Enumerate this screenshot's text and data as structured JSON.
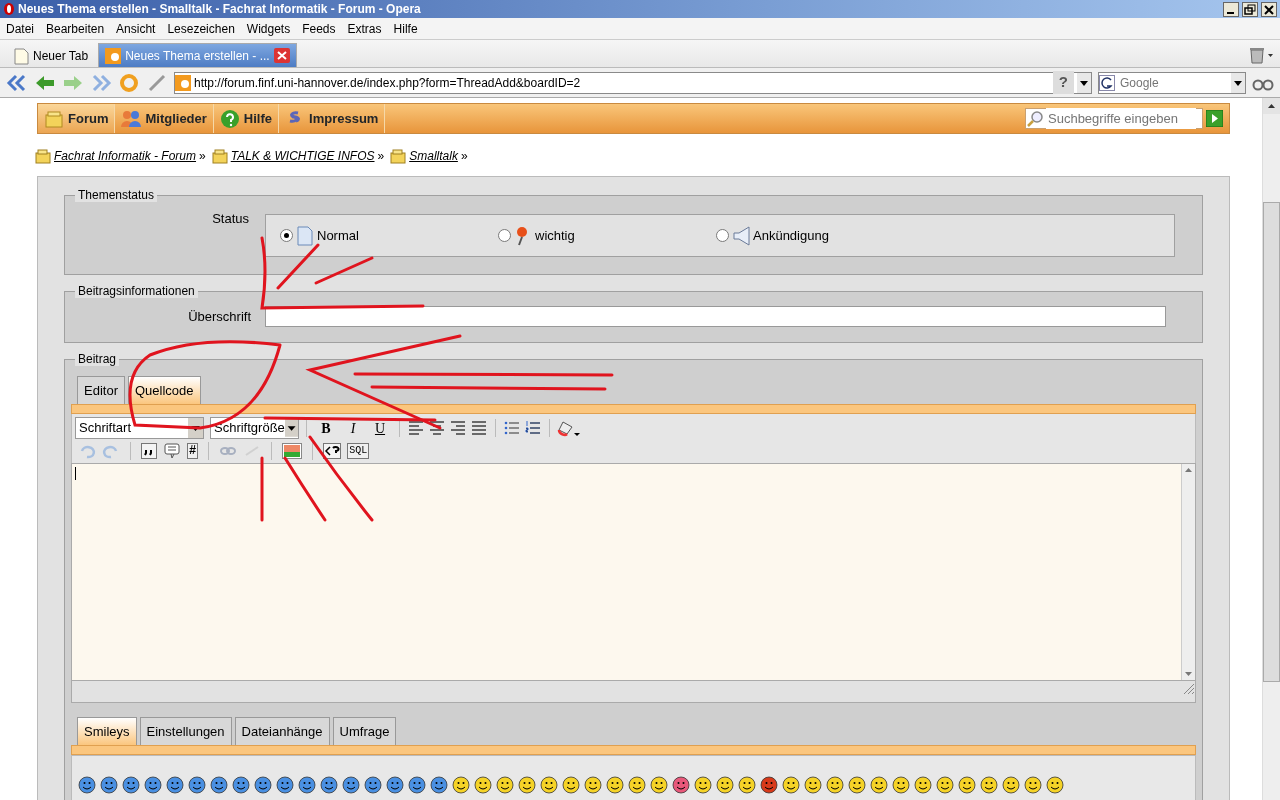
{
  "window": {
    "title": "Neues Thema erstellen - Smalltalk - Fachrat Informatik - Forum - Opera"
  },
  "menu": [
    "Datei",
    "Bearbeiten",
    "Ansicht",
    "Lesezeichen",
    "Widgets",
    "Feeds",
    "Extras",
    "Hilfe"
  ],
  "browser_tabs": [
    {
      "label": "Neuer Tab",
      "selected": false
    },
    {
      "label": "Neues Thema erstellen - ...",
      "selected": true
    }
  ],
  "address_bar": {
    "url": "http://forum.finf.uni-hannover.de/index.php?form=ThreadAdd&boardID=2",
    "help": "?"
  },
  "search_engine": {
    "placeholder": "Google"
  },
  "forum_nav": [
    {
      "label": "Forum",
      "kind": "folder",
      "selected": true
    },
    {
      "label": "Mitglieder",
      "kind": "members",
      "selected": false
    },
    {
      "label": "Hilfe",
      "kind": "help",
      "selected": false
    },
    {
      "label": "Impressum",
      "kind": "paragraph",
      "selected": false
    }
  ],
  "forum_search": {
    "placeholder": "Suchbegriffe eingeben"
  },
  "breadcrumb": [
    {
      "label": "Fachrat Informatik - Forum",
      "sep": "»"
    },
    {
      "label": "TALK & WICHTIGE INFOS",
      "sep": "»"
    },
    {
      "label": "Smalltalk",
      "sep": "»"
    }
  ],
  "themenstatus": {
    "legend": "Themenstatus",
    "label": "Status",
    "options": [
      {
        "label": "Normal",
        "selected": true,
        "kind": "page"
      },
      {
        "label": "wichtig",
        "selected": false,
        "kind": "pin"
      },
      {
        "label": "Ankündigung",
        "selected": false,
        "kind": "megaphone"
      }
    ]
  },
  "beitragsinfo": {
    "legend": "Beitragsinformationen",
    "label": "Überschrift"
  },
  "beitrag": {
    "legend": "Beitrag",
    "editor_tabs": [
      {
        "label": "Editor",
        "selected": false
      },
      {
        "label": "Quellcode",
        "selected": true
      }
    ],
    "font_select": "Schriftart",
    "size_select": "Schriftgröße",
    "format_buttons": [
      "B",
      "I",
      "U"
    ],
    "hash_button": "#",
    "sql_button": "SQL",
    "bottom_tabs": [
      {
        "label": "Smileys",
        "selected": true
      },
      {
        "label": "Einstellungen",
        "selected": false
      },
      {
        "label": "Dateianhänge",
        "selected": false
      },
      {
        "label": "Umfrage",
        "selected": false
      }
    ],
    "smileys": [
      {
        "color": "#4a90e2"
      },
      {
        "color": "#4a90e2"
      },
      {
        "color": "#4a90e2"
      },
      {
        "color": "#4a90e2"
      },
      {
        "color": "#4a90e2"
      },
      {
        "color": "#4a90e2"
      },
      {
        "color": "#4a90e2"
      },
      {
        "color": "#4a90e2"
      },
      {
        "color": "#4a90e2"
      },
      {
        "color": "#4a90e2"
      },
      {
        "color": "#4a90e2"
      },
      {
        "color": "#4a90e2"
      },
      {
        "color": "#4a90e2"
      },
      {
        "color": "#4a90e2"
      },
      {
        "color": "#4a90e2"
      },
      {
        "color": "#4a90e2"
      },
      {
        "color": "#4a90e2"
      },
      {
        "color": "#f5d327"
      },
      {
        "color": "#f5d327"
      },
      {
        "color": "#f5d327"
      },
      {
        "color": "#f5d327"
      },
      {
        "color": "#f5d327"
      },
      {
        "color": "#f5d327"
      },
      {
        "color": "#f5d327"
      },
      {
        "color": "#f5d327"
      },
      {
        "color": "#f5d327"
      },
      {
        "color": "#f5d327"
      },
      {
        "color": "#e8587a"
      },
      {
        "color": "#f5d327"
      },
      {
        "color": "#f5d327"
      },
      {
        "color": "#f5d327"
      },
      {
        "color": "#d83a1a"
      },
      {
        "color": "#f5d327"
      },
      {
        "color": "#f5d327"
      },
      {
        "color": "#f5d327"
      },
      {
        "color": "#f5d327"
      },
      {
        "color": "#f5d327"
      },
      {
        "color": "#f5d327"
      },
      {
        "color": "#f5d327"
      },
      {
        "color": "#f5d327"
      },
      {
        "color": "#f5d327"
      },
      {
        "color": "#f5d327"
      },
      {
        "color": "#f5d327"
      },
      {
        "color": "#f5d327"
      },
      {
        "color": "#f5d327"
      }
    ]
  }
}
